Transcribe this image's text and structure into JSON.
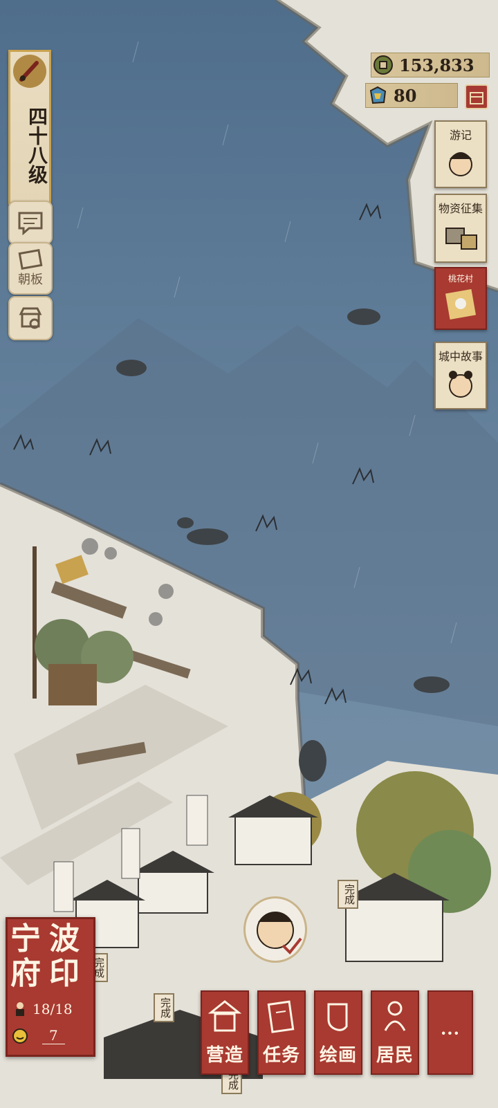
{
  "hud": {
    "level_text": "四十八级",
    "chat_icon": "chat-bubble-icon",
    "board_label": "朝板",
    "shop_icon": "shop-icon"
  },
  "resources": {
    "coins": "153,833",
    "gems": "80"
  },
  "side_cards": [
    {
      "label": "游记"
    },
    {
      "label": "物资征集"
    },
    {
      "label": "桃花村"
    },
    {
      "label": "城中故事"
    }
  ],
  "city": {
    "name_chars": [
      "宁",
      "波",
      "府",
      "印"
    ],
    "residents": "18/18",
    "value": "7"
  },
  "done_tags": [
    "完成",
    "完成",
    "完成",
    "完成"
  ],
  "nav": [
    {
      "label": "营造"
    },
    {
      "label": "任务"
    },
    {
      "label": "绘画"
    },
    {
      "label": "居民"
    },
    {
      "label": "···"
    }
  ],
  "colors": {
    "water": "#5f7a92",
    "land": "#e4e1d8",
    "accent_red": "#a83a31",
    "gold": "#c9a24f"
  }
}
